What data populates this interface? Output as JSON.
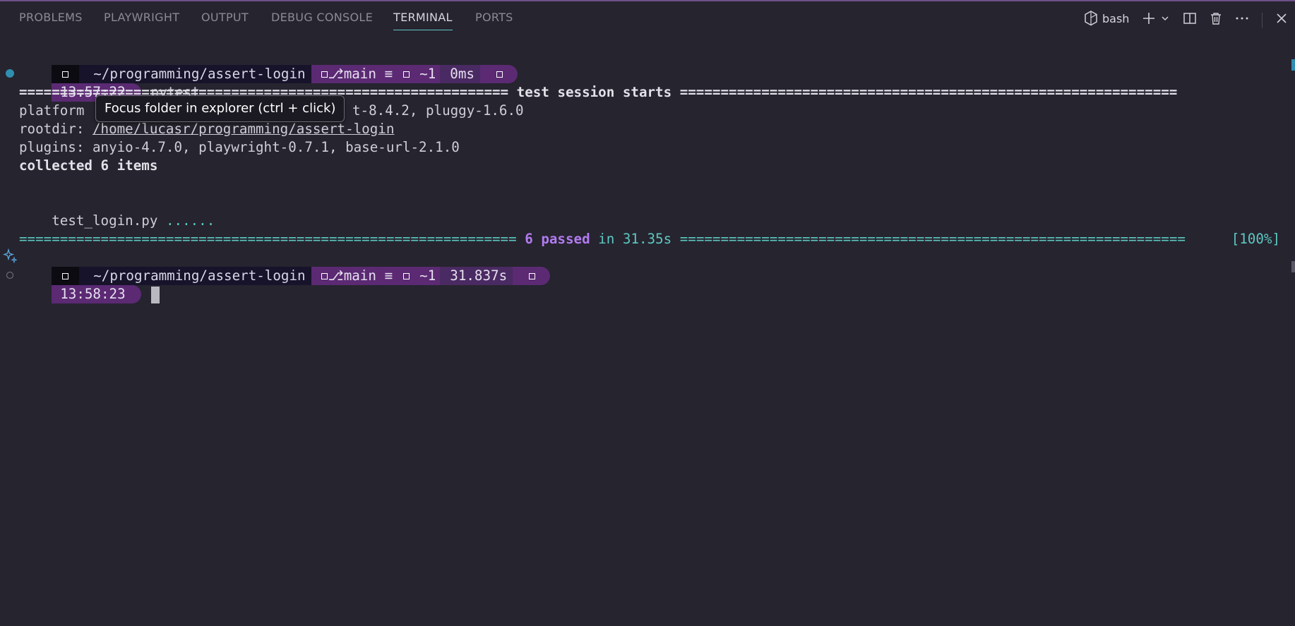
{
  "tabs": [
    {
      "label": "PROBLEMS"
    },
    {
      "label": "PLAYWRIGHT"
    },
    {
      "label": "OUTPUT"
    },
    {
      "label": "DEBUG CONSOLE"
    },
    {
      "label": "TERMINAL",
      "active": true
    },
    {
      "label": "PORTS"
    }
  ],
  "toolbar": {
    "shell_label": "bash",
    "icons": [
      "shell-icon",
      "plus-icon",
      "chevron-down-icon",
      "split-icon",
      "trash-icon",
      "more-icon",
      "close-icon"
    ]
  },
  "terminal": {
    "prompt1": {
      "path": "~/programming/assert-login",
      "branch": "main",
      "status": "≡",
      "changes": "~1",
      "duration": "0ms",
      "time": "13:57:22",
      "command": "pytest"
    },
    "session_header": "============================================================ test session starts =============================================================",
    "platform_line": "platform linux -- Python 3.12.3, pytest-8.4.2, pluggy-1.6.0",
    "platform_prefix": "platform ",
    "platform_suffix": "t-8.4.2, pluggy-1.6.0",
    "rootdir_prefix": "rootdir: ",
    "rootdir_path": "/home/lucasr/programming/assert-login",
    "plugins_line": "plugins: anyio-4.7.0, playwright-0.7.1, base-url-2.1.0",
    "collected_line": "collected 6 items",
    "test_file": "test_login.py",
    "test_dots": "......",
    "progress": "[100%]",
    "summary_left": "============================================================= ",
    "summary_passed": "6 passed",
    "summary_in": " in 31.35s ",
    "summary_right": "==============================================================",
    "prompt2": {
      "path": "~/programming/assert-login",
      "branch": "main",
      "status": "≡",
      "changes": "~1",
      "duration": "31.837s",
      "time": "13:58:23"
    }
  },
  "tooltip": "Focus folder in explorer (ctrl + click)",
  "colors": {
    "background": "#26242f",
    "accent_teal": "#5dc9c2",
    "accent_purple": "#b27bf0",
    "prompt_purple": "#5b2a73"
  }
}
